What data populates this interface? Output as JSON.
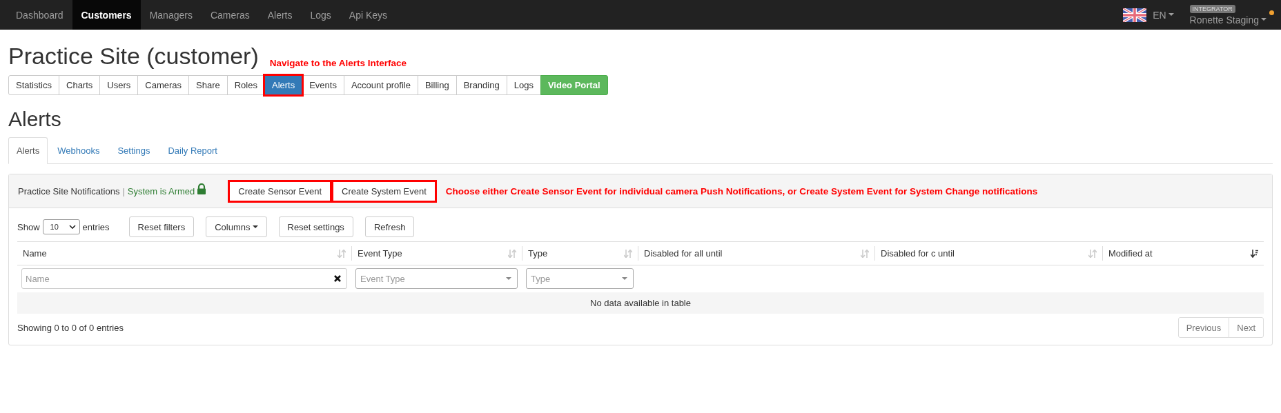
{
  "navbar": {
    "items": [
      {
        "label": "Dashboard",
        "selected": false
      },
      {
        "label": "Customers",
        "selected": true
      },
      {
        "label": "Managers",
        "selected": false
      },
      {
        "label": "Cameras",
        "selected": false
      },
      {
        "label": "Alerts",
        "selected": false
      },
      {
        "label": "Logs",
        "selected": false
      },
      {
        "label": "Api Keys",
        "selected": false
      }
    ],
    "language": "EN",
    "user": {
      "role": "INTEGRATOR",
      "name": "Ronette Staging"
    }
  },
  "page_title": "Practice Site (customer)",
  "site_tabs": {
    "annotation": "Navigate to the Alerts Interface",
    "items": [
      {
        "label": "Statistics",
        "selected": false,
        "highlighted": false,
        "kind": "default"
      },
      {
        "label": "Charts",
        "selected": false,
        "highlighted": false,
        "kind": "default"
      },
      {
        "label": "Users",
        "selected": false,
        "highlighted": false,
        "kind": "default"
      },
      {
        "label": "Cameras",
        "selected": false,
        "highlighted": false,
        "kind": "default"
      },
      {
        "label": "Share",
        "selected": false,
        "highlighted": false,
        "kind": "default"
      },
      {
        "label": "Roles",
        "selected": false,
        "highlighted": false,
        "kind": "default"
      },
      {
        "label": "Alerts",
        "selected": true,
        "highlighted": true,
        "kind": "default"
      },
      {
        "label": "Events",
        "selected": false,
        "highlighted": false,
        "kind": "default"
      },
      {
        "label": "Account profile",
        "selected": false,
        "highlighted": false,
        "kind": "default"
      },
      {
        "label": "Billing",
        "selected": false,
        "highlighted": false,
        "kind": "default"
      },
      {
        "label": "Branding",
        "selected": false,
        "highlighted": false,
        "kind": "default"
      },
      {
        "label": "Logs",
        "selected": false,
        "highlighted": false,
        "kind": "default"
      },
      {
        "label": "Video Portal",
        "selected": false,
        "highlighted": false,
        "kind": "success"
      }
    ]
  },
  "section_title": "Alerts",
  "sub_tabs": [
    {
      "label": "Alerts",
      "selected": true
    },
    {
      "label": "Webhooks",
      "selected": false
    },
    {
      "label": "Settings",
      "selected": false
    },
    {
      "label": "Daily Report",
      "selected": false
    }
  ],
  "panel": {
    "heading": {
      "title": "Practice Site Notifications",
      "separator": "|",
      "status": "System is Armed",
      "locked": true,
      "buttons": [
        {
          "label": "Create Sensor Event",
          "highlighted": true
        },
        {
          "label": "Create System Event",
          "highlighted": true
        }
      ],
      "annotation": "Choose either Create Sensor Event for individual camera Push Notifications, or Create System Event for System Change notifications"
    },
    "controls": {
      "show_label": "Show",
      "page_length": "10",
      "entries_label": "entries",
      "buttons": [
        {
          "label": "Reset filters",
          "kind": "plain"
        },
        {
          "label": "Columns",
          "kind": "dropdown"
        },
        {
          "label": "Reset settings",
          "kind": "plain"
        },
        {
          "label": "Refresh",
          "kind": "plain"
        }
      ]
    },
    "table": {
      "columns": [
        {
          "label": "Name",
          "kind": "sortable"
        },
        {
          "label": "Event Type",
          "kind": "sortable"
        },
        {
          "label": "Type",
          "kind": "sortable"
        },
        {
          "label": "Disabled for all until",
          "kind": "sortable"
        },
        {
          "label": "Disabled for c until",
          "kind": "sortable"
        },
        {
          "label": "Modified at",
          "kind": "sorted"
        }
      ],
      "filters": [
        {
          "kind": "text",
          "placeholder": "Name"
        },
        {
          "kind": "select",
          "placeholder": "Event Type"
        },
        {
          "kind": "select",
          "placeholder": "Type"
        }
      ],
      "empty_message": "No data available in table"
    },
    "info": "Showing 0 to 0 of 0 entries",
    "pagination": [
      {
        "label": "Previous",
        "disabled": true
      },
      {
        "label": "Next",
        "disabled": true
      }
    ]
  }
}
